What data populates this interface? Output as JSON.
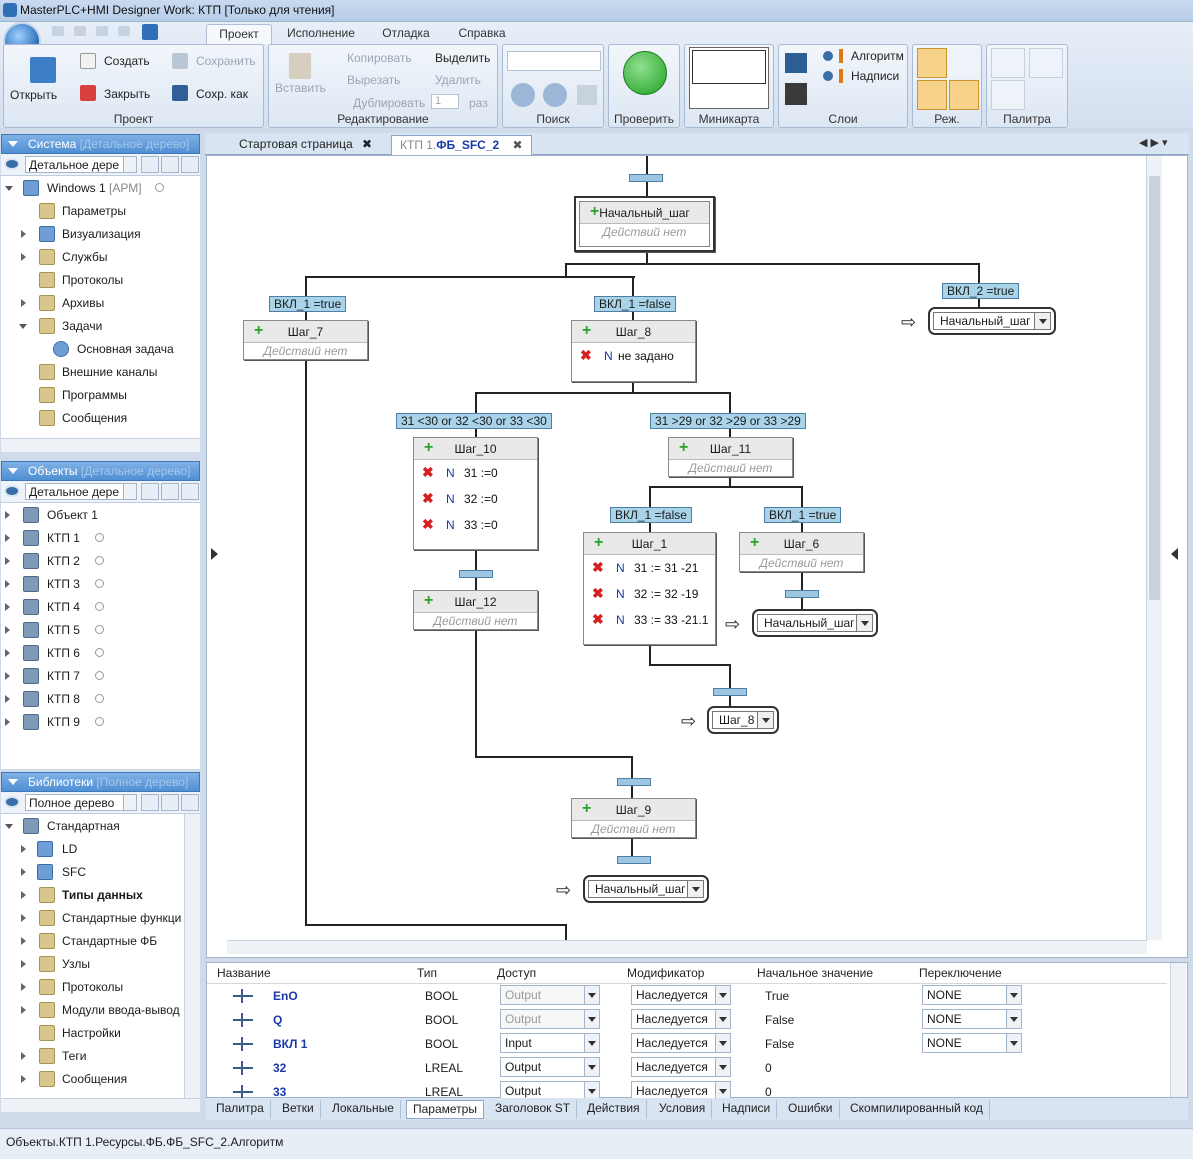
{
  "title": "MasterPLC+HMI Designer Work: КТП [Только для чтения]",
  "ribbon": {
    "tabs": [
      "Проект",
      "Исполнение",
      "Отладка",
      "Справка"
    ],
    "groups": {
      "project": {
        "title": "Проект",
        "open": "Открыть",
        "create": "Создать",
        "save": "Сохранить",
        "close": "Закрыть",
        "save_as": "Сохр. как"
      },
      "edit": {
        "title": "Редактирование",
        "paste": "Вставить",
        "copy": "Копировать",
        "cut": "Вырезать",
        "duplicate": "Дублировать",
        "dup_count": "1",
        "times": "раз",
        "select": "Выделить",
        "delete": "Удалить"
      },
      "search": {
        "title": "Поиск"
      },
      "check": {
        "title": "Проверить"
      },
      "minimap": {
        "title": "Миникарта"
      },
      "layers": {
        "title": "Слои",
        "algorithm": "Алгоритм",
        "labels": "Надписи"
      },
      "mode": {
        "title": "Реж."
      },
      "palette": {
        "title": "Палитра"
      }
    }
  },
  "panels": {
    "system": {
      "title": "Система",
      "hint": "[Детальное дерево]",
      "view": "Детальное дере",
      "root": {
        "label": "Windows 1",
        "suffix": "[АРМ]"
      },
      "items": [
        "Параметры",
        "Визуализация",
        "Службы",
        "Протоколы",
        "Архивы",
        "Задачи",
        "Основная задача",
        "Внешние каналы",
        "Программы",
        "Сообщения"
      ]
    },
    "objects": {
      "title": "Объекты",
      "hint": "[Детальное дерево]",
      "view": "Детальное дере",
      "items": [
        "Объект 1",
        "КТП 1",
        "КТП 2",
        "КТП 3",
        "КТП 4",
        "КТП 5",
        "КТП 6",
        "КТП 7",
        "КТП 8",
        "КТП 9"
      ]
    },
    "libraries": {
      "title": "Библиотеки",
      "hint": "[Полное дерево]",
      "view": "Полное дерево",
      "items": [
        "Стандартная",
        "LD",
        "SFC",
        "Типы данных",
        "Стандартные функци",
        "Стандартные ФБ",
        "Узлы",
        "Протоколы",
        "Модули ввода-вывод",
        "Настройки",
        "Теги",
        "Сообщения"
      ]
    }
  },
  "editor_tabs": {
    "start": "Стартовая страница",
    "current_prefix": "КТП 1.",
    "current": "ФБ_SFC_2"
  },
  "sfc": {
    "no_actions": "Действий нет",
    "steps": {
      "init": "Начальный_шаг",
      "s7": "Шаг_7",
      "s8": "Шаг_8",
      "s10": "Шаг_10",
      "s11": "Шаг_11",
      "s12": "Шаг_12",
      "s1": "Шаг_1",
      "s6": "Шаг_6",
      "s9": "Шаг_9"
    },
    "actions": {
      "s8_q": "N",
      "s8_v": "не задано",
      "s10": [
        {
          "q": "N",
          "v": "31 :=0"
        },
        {
          "q": "N",
          "v": "32 :=0"
        },
        {
          "q": "N",
          "v": "33 :=0"
        }
      ],
      "s1": [
        {
          "q": "N",
          "v": "31 := 31 -21"
        },
        {
          "q": "N",
          "v": "32 := 32 -19"
        },
        {
          "q": "N",
          "v": "33 := 33 -21.1"
        }
      ]
    },
    "conditions": {
      "c1": "ВКЛ_1 =true",
      "c2": "ВКЛ_1 =false",
      "c3": "ВКЛ_2 =true",
      "c4": "31 <30 or  32 <30 or 33 <30",
      "c5": "31 >29 or  32 >29 or 33 >29",
      "c6": "ВКЛ_1 =false",
      "c7": "ВКЛ_1 =true"
    },
    "jumps": {
      "j1": "Начальный_шаг",
      "j2": "Начальный_шаг",
      "j3": "Шаг_8",
      "j4": "Начальный_шаг"
    }
  },
  "properties": {
    "headers": [
      "Название",
      "Тип",
      "Доступ",
      "Модификатор",
      "Начальное значение",
      "Переключение"
    ],
    "rows": [
      {
        "name": "EnO",
        "type": "BOOL",
        "access": "Output",
        "access_disabled": true,
        "mod": "Наследуется",
        "init": "True",
        "sw": "NONE"
      },
      {
        "name": "Q",
        "type": "BOOL",
        "access": "Output",
        "access_disabled": true,
        "mod": "Наследуется",
        "init": "False",
        "sw": "NONE"
      },
      {
        "name": "ВКЛ 1",
        "type": "BOOL",
        "access": "Input",
        "access_disabled": false,
        "mod": "Наследуется",
        "init": "False",
        "sw": "NONE"
      },
      {
        "name": "32",
        "type": "LREAL",
        "access": "Output",
        "access_disabled": false,
        "mod": "Наследуется",
        "init": "0",
        "sw": ""
      },
      {
        "name": "33",
        "type": "LREAL",
        "access": "Output",
        "access_disabled": false,
        "mod": "Наследуется",
        "init": "0",
        "sw": ""
      }
    ]
  },
  "bottom_tabs": [
    "Палитра",
    "Ветки",
    "Локальные",
    "Параметры",
    "Заголовок ST",
    "Действия",
    "Условия",
    "Надписи",
    "Ошибки",
    "Скомпилированный код"
  ],
  "status": "Объекты.КТП 1.Ресурсы.ФБ.ФБ_SFC_2.Алгоритм"
}
